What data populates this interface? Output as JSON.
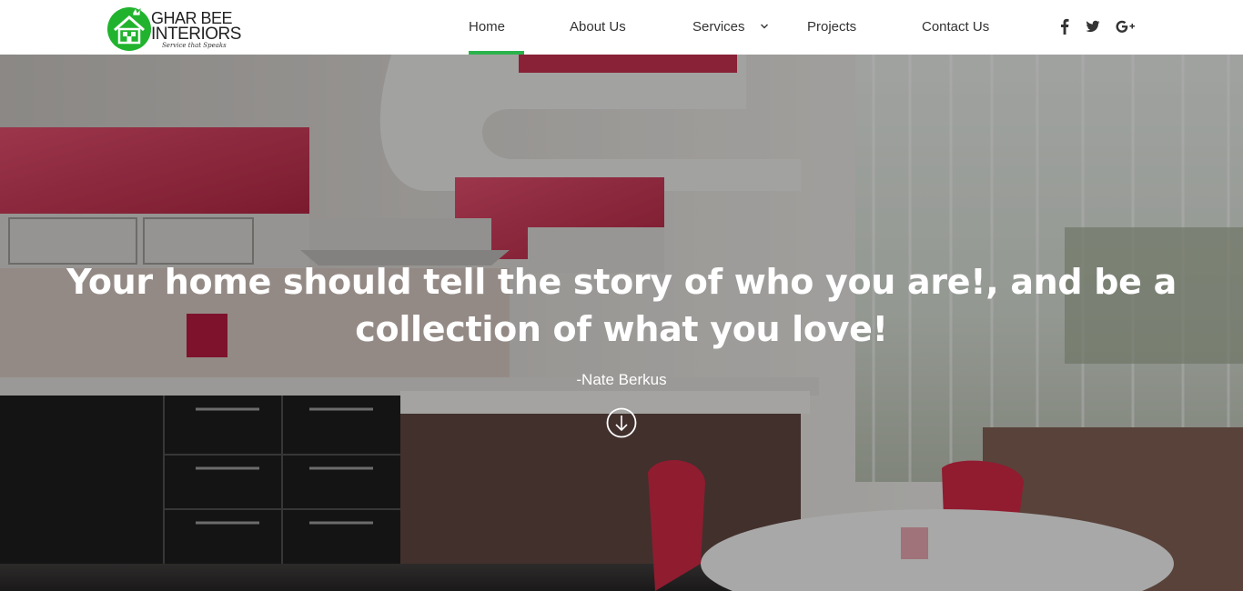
{
  "brand": {
    "name_line1": "GHAR BEE",
    "name_line2": "INTERIORS",
    "tagline": "Service that Speaks",
    "color": "#2bb34b"
  },
  "nav": {
    "home": "Home",
    "about": "About Us",
    "services": "Services",
    "projects": "Projects",
    "contact": "Contact Us",
    "active": "Home",
    "active_color": "#2bb34b"
  },
  "social": {
    "icons": [
      "facebook-icon",
      "twitter-icon",
      "google-plus-icon"
    ]
  },
  "hero": {
    "quote": "Your home should tell the story of who you are!, and be a collection of what you love!",
    "author": "-Nate Berkus",
    "scroll_icon": "arrow-down-circle-icon"
  }
}
